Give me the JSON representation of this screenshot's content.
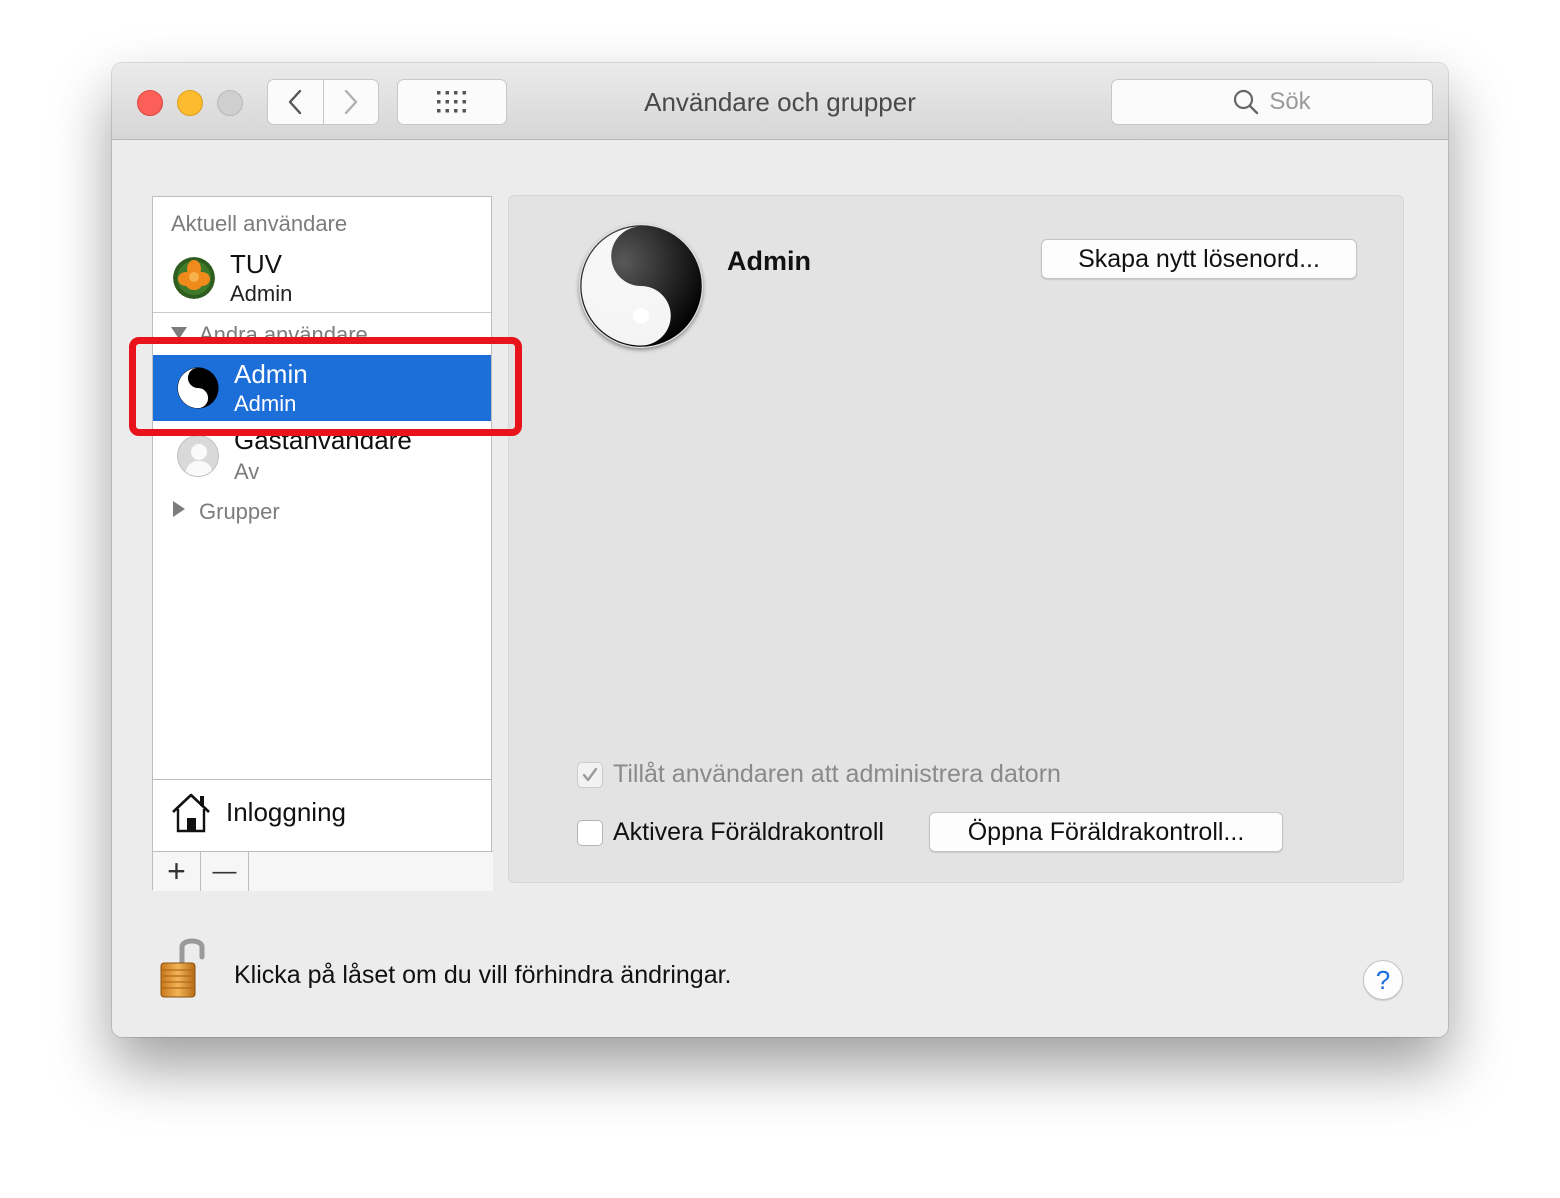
{
  "window": {
    "title": "Användare och grupper",
    "search_placeholder": "Sök"
  },
  "sidebar": {
    "current_section": "Aktuell användare",
    "current_user": {
      "name": "TUV",
      "role": "Admin",
      "avatar": "flower-avatar"
    },
    "other_section": "Andra användare",
    "other_users": [
      {
        "name": "Admin",
        "role": "Admin",
        "avatar": "yin-yang-avatar",
        "selected": true
      },
      {
        "name": "Gästanvändare",
        "role": "Av",
        "avatar": "generic-user-avatar",
        "selected": false
      }
    ],
    "groups_label": "Grupper",
    "login_options_label": "Inloggning",
    "add_symbol": "+",
    "remove_symbol": "—"
  },
  "detail": {
    "user_name": "Admin",
    "reset_password_label": "Skapa nytt lösenord...",
    "allow_admin_label": "Tillåt användaren att administrera datorn",
    "allow_admin_checked": true,
    "allow_admin_enabled": false,
    "parental_label": "Aktivera Föräldrakontroll",
    "parental_checked": false,
    "open_parental_label": "Öppna Föräldrakontroll..."
  },
  "footer": {
    "lock_text": "Klicka på låset om du vill förhindra ändringar.",
    "help_symbol": "?"
  },
  "colors": {
    "selection": "#1c6fd8",
    "highlight_box": "#e8131b"
  }
}
